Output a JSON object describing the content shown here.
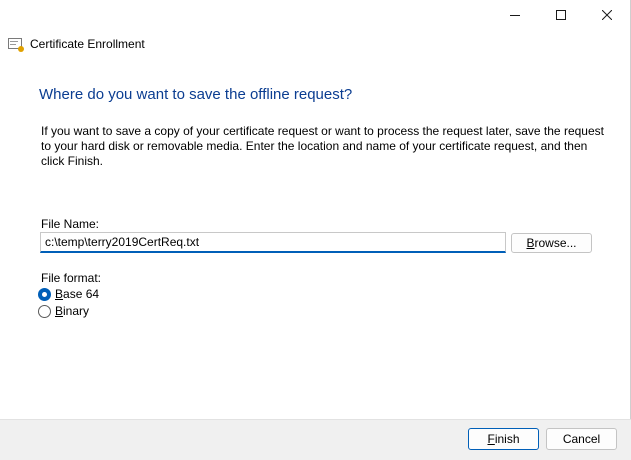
{
  "window": {
    "title": "Certificate Enrollment",
    "controls": [
      "minimize-icon",
      "maximize-icon",
      "close-icon"
    ]
  },
  "page": {
    "heading": "Where do you want to save the offline request?",
    "instructions": "If you want to save a copy of your certificate request or want to process the request later, save the request to your hard disk or removable media. Enter the location and name of your certificate request, and then click Finish."
  },
  "file_name": {
    "label": "File Name:",
    "value": "c:\\temp\\terry2019CertReq.txt",
    "browse_label_pre": "B",
    "browse_label_rest": "rowse..."
  },
  "file_format": {
    "label": "File format:",
    "options": [
      {
        "label_pre": "B",
        "label_rest": "ase 64",
        "selected": true
      },
      {
        "label_pre": "B",
        "label_rest": "inary",
        "selected": false
      }
    ]
  },
  "buttons": {
    "finish_pre": "F",
    "finish_rest": "inish",
    "cancel": "Cancel"
  },
  "colors": {
    "accent": "#005fb8",
    "heading": "#0b3d91",
    "footer": "#f0f0f0"
  }
}
